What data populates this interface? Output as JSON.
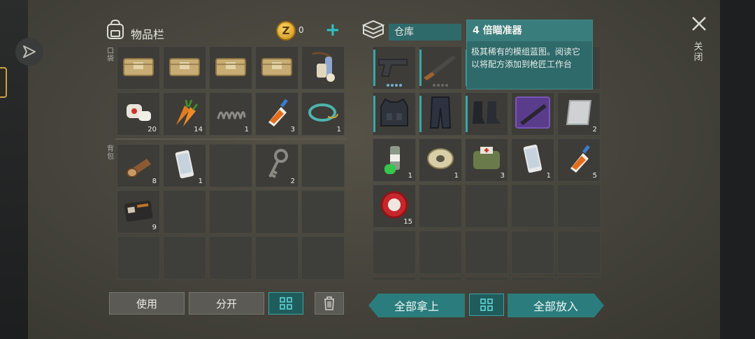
{
  "inventory": {
    "title": "物品栏",
    "coin_symbol": "Z",
    "coins": "0",
    "pocket_label": "口袋",
    "backpack_label": "背包",
    "pocket_slots": [
      {
        "icon": "crate-icon",
        "count": ""
      },
      {
        "icon": "crate-icon",
        "count": ""
      },
      {
        "icon": "crate-icon",
        "count": ""
      },
      {
        "icon": "crate-icon",
        "count": ""
      },
      {
        "icon": "bandage-roll-icon",
        "count": ""
      },
      {
        "icon": "first-aid-bandage-icon",
        "count": "20"
      },
      {
        "icon": "carrot-icon",
        "count": "14"
      },
      {
        "icon": "spring-icon",
        "count": "1"
      },
      {
        "icon": "glue-icon",
        "count": "3"
      },
      {
        "icon": "wire-coil-icon",
        "count": "1"
      }
    ],
    "backpack_slots": [
      {
        "icon": "log-icon",
        "count": "8"
      },
      {
        "icon": "phone-icon",
        "count": "1"
      },
      {
        "icon": "",
        "count": ""
      },
      {
        "icon": "key-icon",
        "count": "2"
      },
      {
        "icon": "",
        "count": ""
      },
      {
        "icon": "wallet-icon",
        "count": "9"
      },
      {
        "icon": "",
        "count": ""
      },
      {
        "icon": "",
        "count": ""
      },
      {
        "icon": "",
        "count": ""
      },
      {
        "icon": "",
        "count": ""
      },
      {
        "icon": "",
        "count": ""
      },
      {
        "icon": "",
        "count": ""
      },
      {
        "icon": "",
        "count": ""
      },
      {
        "icon": "",
        "count": ""
      },
      {
        "icon": "",
        "count": ""
      }
    ],
    "buttons": {
      "use": "使用",
      "split": "分开"
    }
  },
  "warehouse": {
    "title": "仓库",
    "slots": [
      {
        "icon": "pistol-icon",
        "count": "",
        "equip": true,
        "durability": 4
      },
      {
        "icon": "shotgun-icon",
        "count": "",
        "equip": true,
        "durability": 0
      },
      {
        "icon": "",
        "count": "",
        "equip": true
      },
      {
        "icon": "",
        "count": "",
        "equip": false
      },
      {
        "icon": "",
        "count": "",
        "equip": false
      },
      {
        "icon": "tactical-vest-icon",
        "count": "",
        "equip": true
      },
      {
        "icon": "tactical-pants-icon",
        "count": "",
        "equip": true
      },
      {
        "icon": "boots-icon",
        "count": "",
        "equip": true
      },
      {
        "icon": "rifle-blueprint-icon",
        "count": "",
        "equip": false
      },
      {
        "icon": "metal-sheet-icon",
        "count": "2",
        "equip": false
      },
      {
        "icon": "spray-can-icon",
        "count": "1",
        "equip": false
      },
      {
        "icon": "thread-spool-icon",
        "count": "1",
        "equip": false
      },
      {
        "icon": "medkit-bag-icon",
        "count": "3",
        "equip": false
      },
      {
        "icon": "phone-icon",
        "count": "1",
        "equip": false
      },
      {
        "icon": "glue-icon",
        "count": "5",
        "equip": false
      },
      {
        "icon": "bottle-cap-icon",
        "count": "15",
        "equip": false
      },
      {
        "icon": "",
        "count": ""
      },
      {
        "icon": "",
        "count": ""
      },
      {
        "icon": "",
        "count": ""
      },
      {
        "icon": "",
        "count": ""
      },
      {
        "icon": "",
        "count": ""
      },
      {
        "icon": "",
        "count": ""
      },
      {
        "icon": "",
        "count": ""
      },
      {
        "icon": "",
        "count": ""
      },
      {
        "icon": "",
        "count": ""
      },
      {
        "icon": "",
        "count": ""
      },
      {
        "icon": "",
        "count": ""
      },
      {
        "icon": "",
        "count": ""
      },
      {
        "icon": "",
        "count": ""
      },
      {
        "icon": "",
        "count": ""
      }
    ],
    "buttons": {
      "take_all": "全部拿上",
      "put_all": "全部放入"
    }
  },
  "tooltip": {
    "title": "4 倍瞄准器",
    "description": "极其稀有的模组蓝图。阅读它以将配方添加到枪匠工作台"
  },
  "close_label": "关闭",
  "colors": {
    "accent": "#2b7c7c",
    "panel": "#46443c",
    "slot": "#3d3c38"
  }
}
